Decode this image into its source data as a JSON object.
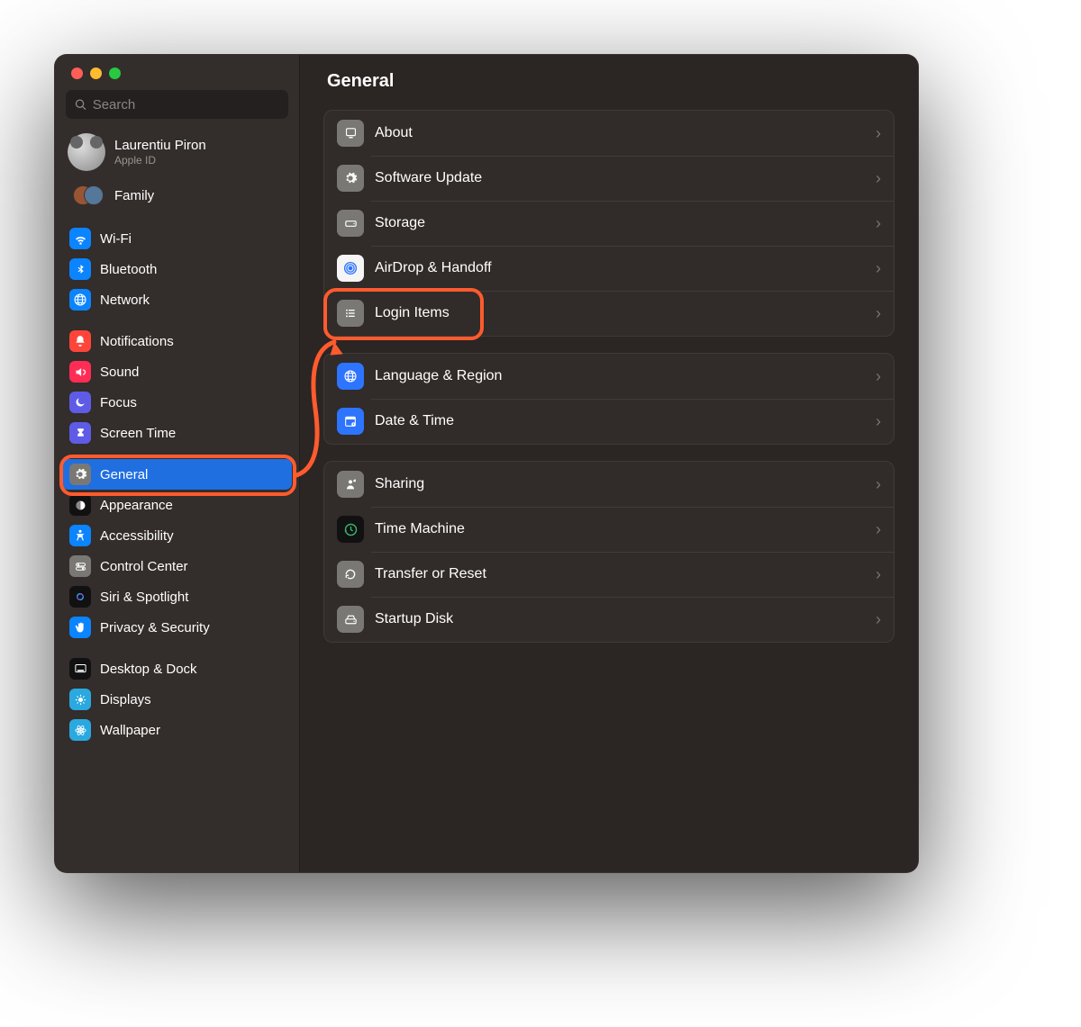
{
  "search": {
    "placeholder": "Search"
  },
  "account": {
    "name": "Laurentiu Piron",
    "sub": "Apple ID"
  },
  "family": {
    "label": "Family"
  },
  "sidebar": {
    "groups": [
      [
        {
          "label": "Wi-Fi",
          "color": "bg-blue",
          "icon": "wifi"
        },
        {
          "label": "Bluetooth",
          "color": "bg-blue",
          "icon": "bt"
        },
        {
          "label": "Network",
          "color": "bg-blue",
          "icon": "globe"
        }
      ],
      [
        {
          "label": "Notifications",
          "color": "bg-red",
          "icon": "bell"
        },
        {
          "label": "Sound",
          "color": "bg-pink",
          "icon": "sound"
        },
        {
          "label": "Focus",
          "color": "bg-indigo",
          "icon": "moon"
        },
        {
          "label": "Screen Time",
          "color": "bg-indigo",
          "icon": "hourglass"
        }
      ],
      [
        {
          "label": "General",
          "color": "bg-gray",
          "icon": "gear",
          "selected": true
        },
        {
          "label": "Appearance",
          "color": "bg-dark",
          "icon": "appearance"
        },
        {
          "label": "Accessibility",
          "color": "bg-blue",
          "icon": "acc"
        },
        {
          "label": "Control Center",
          "color": "bg-gray",
          "icon": "cc"
        },
        {
          "label": "Siri & Spotlight",
          "color": "bg-dark",
          "icon": "siri"
        },
        {
          "label": "Privacy & Security",
          "color": "bg-blue",
          "icon": "hand"
        }
      ],
      [
        {
          "label": "Desktop & Dock",
          "color": "bg-dark",
          "icon": "dock"
        },
        {
          "label": "Displays",
          "color": "bg-cyan",
          "icon": "display"
        },
        {
          "label": "Wallpaper",
          "color": "bg-cyan",
          "icon": "wallpaper"
        }
      ]
    ]
  },
  "content": {
    "title": "General",
    "groups": [
      [
        {
          "label": "About",
          "icon": "about",
          "color": "bg-gray"
        },
        {
          "label": "Software Update",
          "icon": "gear",
          "color": "bg-gray"
        },
        {
          "label": "Storage",
          "icon": "storage",
          "color": "bg-gray"
        },
        {
          "label": "AirDrop & Handoff",
          "icon": "airdrop",
          "color": "bg-white"
        },
        {
          "label": "Login Items",
          "icon": "list",
          "color": "bg-gray",
          "highlighted": true
        }
      ],
      [
        {
          "label": "Language & Region",
          "icon": "globe",
          "color": "bg-blue2"
        },
        {
          "label": "Date & Time",
          "icon": "cal",
          "color": "bg-blue2"
        }
      ],
      [
        {
          "label": "Sharing",
          "icon": "share",
          "color": "bg-gray"
        },
        {
          "label": "Time Machine",
          "icon": "tm",
          "color": "bg-dark"
        },
        {
          "label": "Transfer or Reset",
          "icon": "reset",
          "color": "bg-gray"
        },
        {
          "label": "Startup Disk",
          "icon": "disk",
          "color": "bg-gray"
        }
      ]
    ]
  },
  "annotation": {
    "color": "#ff5b2e"
  }
}
